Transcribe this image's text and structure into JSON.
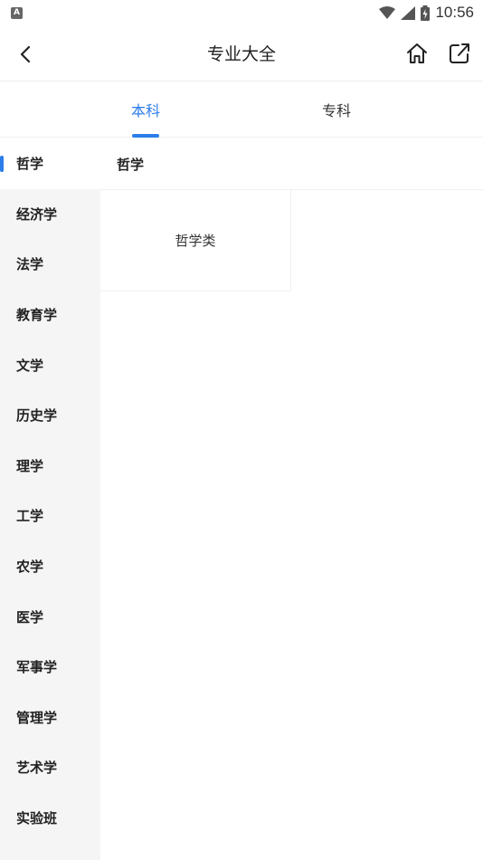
{
  "status_bar": {
    "notification_icon_letter": "A",
    "time": "10:56"
  },
  "header": {
    "title": "专业大全"
  },
  "tabs": [
    {
      "label": "本科",
      "active": true
    },
    {
      "label": "专科",
      "active": false
    }
  ],
  "sidebar": {
    "items": [
      {
        "label": "哲学",
        "active": true
      },
      {
        "label": "经济学"
      },
      {
        "label": "法学"
      },
      {
        "label": "教育学"
      },
      {
        "label": "文学"
      },
      {
        "label": "历史学"
      },
      {
        "label": "理学"
      },
      {
        "label": "工学"
      },
      {
        "label": "农学"
      },
      {
        "label": "医学"
      },
      {
        "label": "军事学"
      },
      {
        "label": "管理学"
      },
      {
        "label": "艺术学"
      },
      {
        "label": "实验班"
      }
    ]
  },
  "content": {
    "section_title": "哲学",
    "categories": [
      {
        "label": "哲学类"
      }
    ]
  },
  "colors": {
    "accent": "#2b7de9",
    "sidebar_bg": "#f5f5f5"
  }
}
